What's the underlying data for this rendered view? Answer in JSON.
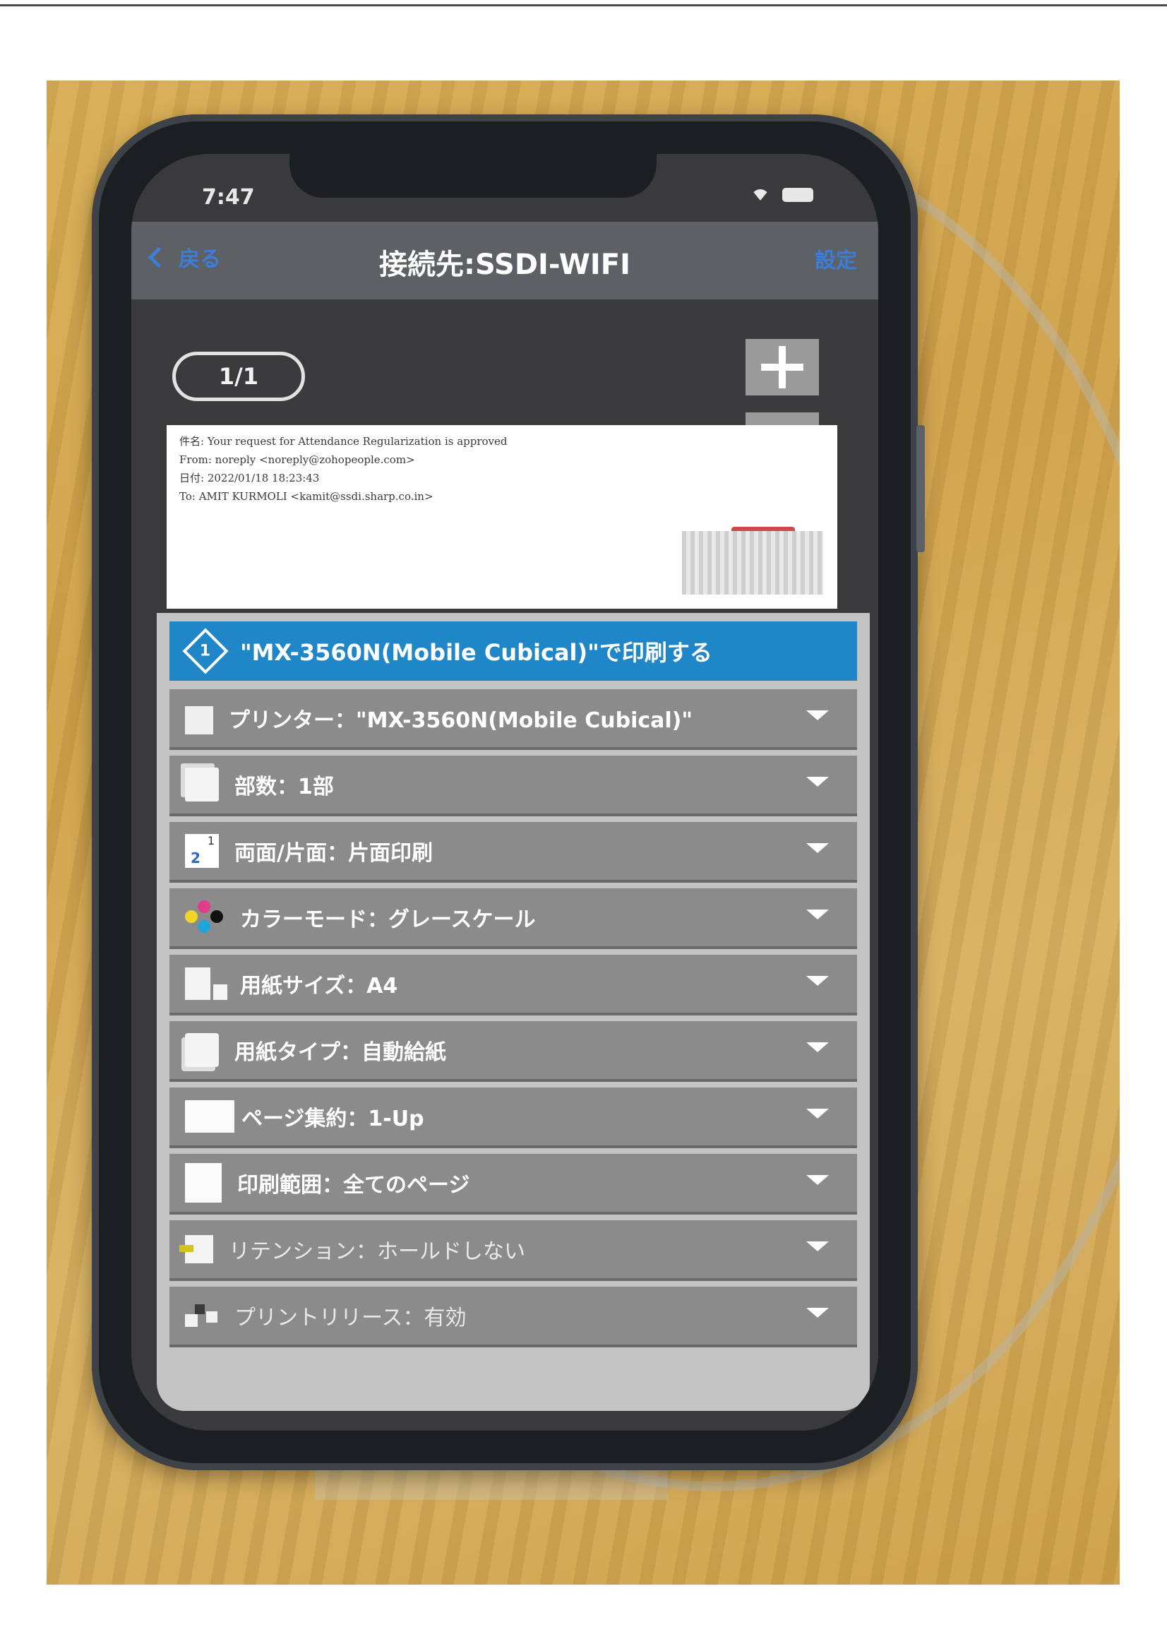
{
  "status_bar": {
    "time": "7:47"
  },
  "nav": {
    "back_label": "戻る",
    "title": "接続先:SSDI-WIFI",
    "right_label": "設定"
  },
  "preview": {
    "page_counter": "1/1",
    "email_lines": [
      "件名: Your request for Attendance Regularization is approved",
      "From: noreply <noreply@zohopeople.com>",
      "日付: 2022/01/18 18:23:43",
      "To: AMIT KURMOLI <kamit@ssdi.sharp.co.in>"
    ]
  },
  "print_panel": {
    "print_button_label": "\"MX-3560N(Mobile Cubical)\"で印刷する",
    "settings": [
      {
        "icon": "printer-icon",
        "label": "プリンター：\"MX-3560N(Mobile Cubical)\""
      },
      {
        "icon": "copies-icon",
        "label": "部数：1部"
      },
      {
        "icon": "duplex-icon",
        "label": "両面/片面：片面印刷"
      },
      {
        "icon": "color-mode-icon",
        "label": "カラーモード：グレースケール"
      },
      {
        "icon": "paper-size-icon",
        "label": "用紙サイズ：A4"
      },
      {
        "icon": "paper-type-icon",
        "label": "用紙タイプ：自動給紙"
      },
      {
        "icon": "n-up-icon",
        "label": "ページ集約：1-Up"
      },
      {
        "icon": "print-range-icon",
        "label": "印刷範囲：全てのページ"
      },
      {
        "icon": "retention-icon",
        "label": "リテンション：ホールドしない"
      },
      {
        "icon": "print-release-icon",
        "label": "プリントリリース：有効"
      }
    ]
  },
  "colors": {
    "accent_blue": "#1f86c8",
    "link_blue": "#3d7dd8",
    "row_gray": "#8b8b8b",
    "wood": "#d7ad55"
  }
}
